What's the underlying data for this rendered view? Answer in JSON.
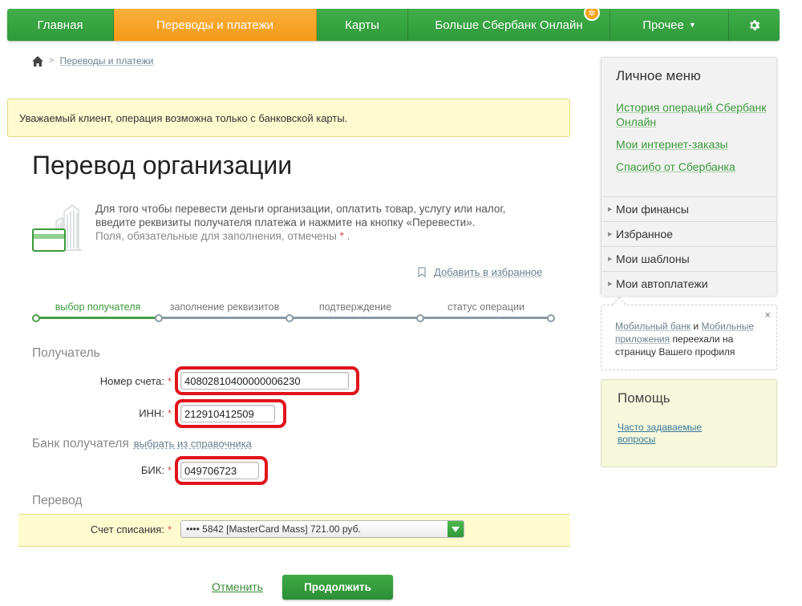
{
  "nav": {
    "items": [
      {
        "label": "Главная"
      },
      {
        "label": "Переводы и платежи"
      },
      {
        "label": "Карты"
      },
      {
        "label": "Больше Сбербанк Онлайн"
      },
      {
        "label": "Прочее"
      }
    ],
    "badge_icon": "gear-badge-icon",
    "settings_icon": "gear-icon"
  },
  "breadcrumb": {
    "home_icon": "home-icon",
    "current": "Переводы и платежи"
  },
  "notice": "Уважаемый клиент, операция возможна только с банковской карты.",
  "title": "Перевод организации",
  "description": {
    "line1": "Для того чтобы перевести деньги организации, оплатить товар, услугу или налог,",
    "line2": "введите реквизиты получателя платежа и нажмите на кнопку «Перевести».",
    "line3": "Поля, обязательные для заполнения, отмечены",
    "required_mark": "*",
    "line3_end": "."
  },
  "favorite": "Добавить в избранное",
  "steps": [
    {
      "label": "выбор получателя",
      "active": true
    },
    {
      "label": "заполнение реквизитов",
      "active": false
    },
    {
      "label": "подтверждение",
      "active": false
    },
    {
      "label": "статус операции",
      "active": false
    }
  ],
  "recipient": {
    "section": "Получатель",
    "account_label": "Номер счета:",
    "account_value": "40802810400000006230",
    "inn_label": "ИНН:",
    "inn_value": "212910412509"
  },
  "bank": {
    "section": "Банк получателя",
    "choose_link": "выбрать из справочника",
    "bik_label": "БИК:",
    "bik_value": "049706723"
  },
  "transfer": {
    "section": "Перевод",
    "debit_label": "Счет списания:",
    "debit_value": "•••• 5842 [MasterCard Mass] 721.00 руб."
  },
  "required_mark": "*",
  "actions": {
    "cancel": "Отменить",
    "continue": "Продолжить"
  },
  "sidebar": {
    "personal_title": "Личное меню",
    "links": [
      "История операций Сбербанк Онлайн",
      "Мои интернет-заказы",
      "Спасибо от Сбербанка"
    ],
    "items": [
      "Мои финансы",
      "Избранное",
      "Мои шаблоны",
      "Мои автоплатежи"
    ],
    "mobile_note": {
      "link1": "Мобильный банк",
      "and": "и",
      "link2": "Мобильные приложения",
      "rest": "переехали на страницу Вашего профиля",
      "close": "×"
    },
    "help_title": "Помощь",
    "help_link": "Часто задаваемые вопросы"
  },
  "colors": {
    "brand_green": "#2f9a3a",
    "active_orange": "#f7a21c",
    "highlight_red": "#e0131b",
    "notice_bg": "#fffbcf"
  }
}
